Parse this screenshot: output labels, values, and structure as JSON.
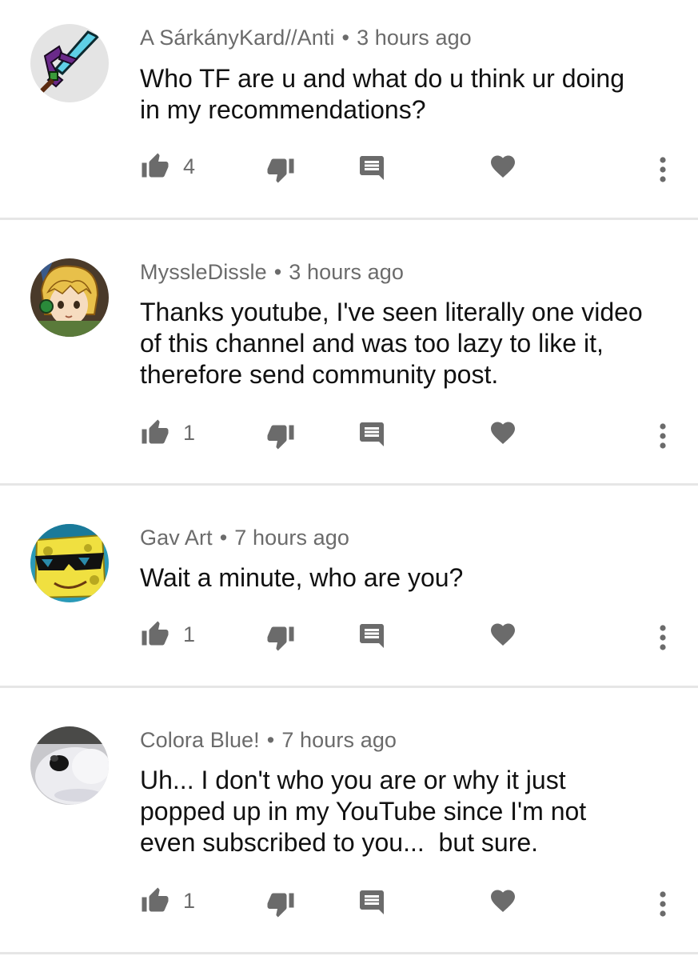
{
  "comments": [
    {
      "author": "A SárkányKard//Anti",
      "time": "3 hours ago",
      "lines": [
        "Who TF are u and what do u think ur doing",
        "in my recommendations?"
      ],
      "likes": "4",
      "avatar_icon": "sword-avatar"
    },
    {
      "author": "MyssleDissle",
      "time": "3 hours ago",
      "lines": [
        "Thanks youtube, I've seen literally one video",
        "of this channel and was too lazy to like it,",
        "therefore send community post."
      ],
      "likes": "1",
      "avatar_icon": "anime-character-avatar"
    },
    {
      "author": "Gav Art",
      "time": "7 hours ago",
      "lines": [
        "Wait a minute, who are you?"
      ],
      "likes": "1",
      "avatar_icon": "sponge-sunglasses-avatar"
    },
    {
      "author": "Colora Blue!",
      "time": "7 hours ago",
      "lines": [
        "Uh... I don't who you are or why it just",
        "popped up in my YouTube since I'm not",
        "even subscribed to you...  but sure."
      ],
      "likes": "1",
      "avatar_icon": "white-fluffy-avatar"
    }
  ],
  "separator": "•",
  "colors": {
    "icon": "#6b6b6b",
    "text": "#111111",
    "meta": "#6b6b6b",
    "divider": "#e6e6e6"
  }
}
